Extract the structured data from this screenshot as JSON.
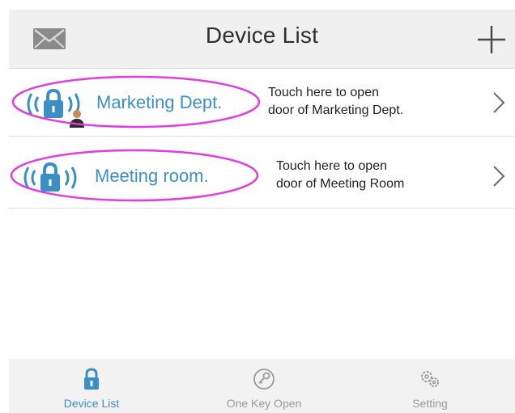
{
  "header": {
    "title": "Device List",
    "left_icon": "envelope-icon",
    "right_icon": "plus-icon"
  },
  "devices": [
    {
      "name": "Marketing Dept.",
      "hint_line1": "Touch here to open",
      "hint_line2": "door of Marketing Dept.",
      "icon": "wireless-lock-icon",
      "badge_icon": "user-avatar-icon"
    },
    {
      "name": "Meeting room.",
      "hint_line1": "Touch here to open",
      "hint_line2": "door of Meeting Room",
      "icon": "wireless-lock-icon"
    }
  ],
  "tabs": [
    {
      "label": "Device List",
      "icon": "lock-icon",
      "active": true
    },
    {
      "label": "One Key Open",
      "icon": "key-icon",
      "active": false
    },
    {
      "label": "Setting",
      "icon": "gears-icon",
      "active": false
    }
  ],
  "colors": {
    "accent": "#3a8fc4",
    "annotation": "#e23be0",
    "header_bg": "#f0f0f0",
    "tabbar_bg": "#f2f2f2",
    "inactive": "#9a9a9a"
  }
}
